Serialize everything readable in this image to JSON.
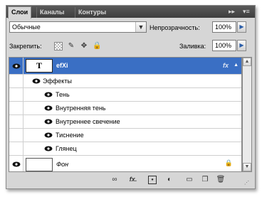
{
  "tabs": [
    "Слои",
    "Каналы",
    "Контуры"
  ],
  "blend_mode": "Обычные",
  "opacity_label": "Непрозрачность:",
  "opacity_value": "100%",
  "lock_label": "Закрепить:",
  "fill_label": "Заливка:",
  "fill_value": "100%",
  "layers": {
    "text_layer": {
      "thumb": "T",
      "name": "efXi",
      "fx": "fx"
    },
    "effects_label": "Эффекты",
    "effects": [
      "Тень",
      "Внутренняя тень",
      "Внутреннее свечение",
      "Тиснение",
      "Глянец"
    ],
    "background": {
      "name": "Фон"
    }
  },
  "icons": {
    "tab_menu": "menu-icon",
    "collapse": "double-arrow-icon",
    "lock": [
      "lock-transparency-icon",
      "lock-brush-icon",
      "lock-move-icon",
      "lock-all-icon"
    ],
    "bottom": [
      "link-icon",
      "fx-icon",
      "mask-icon",
      "adjustment-icon",
      "folder-icon",
      "new-layer-icon",
      "trash-icon"
    ]
  },
  "colors": {
    "selection": "#3a6fc4",
    "panel": "#d6d6d6",
    "tabbar": "#4a4a4a"
  }
}
